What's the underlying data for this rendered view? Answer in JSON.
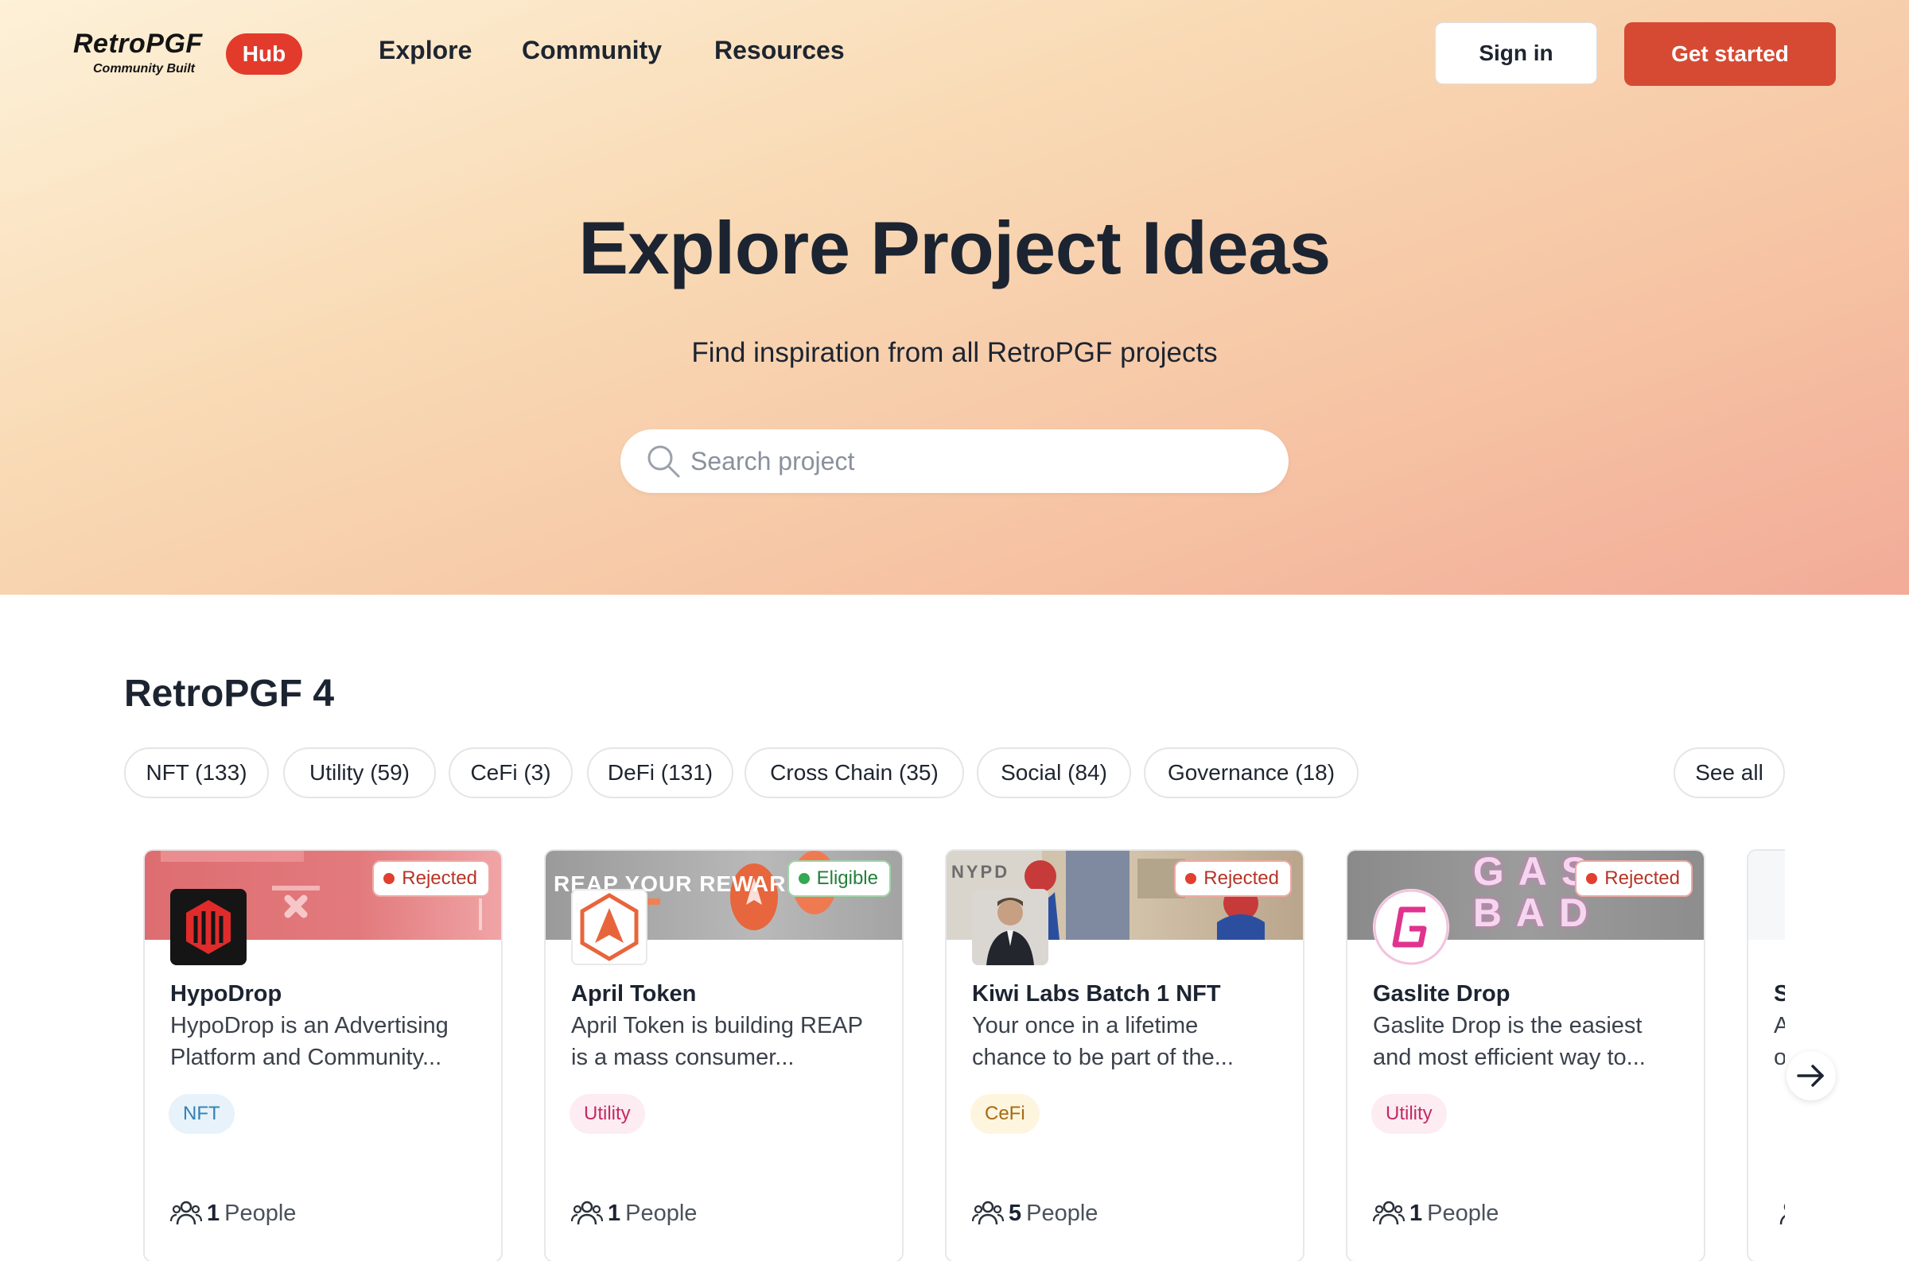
{
  "nav": {
    "logo_title": "RetroPGF",
    "logo_subtitle": "Community Built",
    "hub_badge": "Hub",
    "links": [
      "Explore",
      "Community",
      "Resources"
    ],
    "sign_in": "Sign in",
    "get_started": "Get started"
  },
  "hero": {
    "title": "Explore Project Ideas",
    "subtitle": "Find inspiration from all RetroPGF projects",
    "search_placeholder": "Search project"
  },
  "section": {
    "title": "RetroPGF 4",
    "categories": [
      "NFT (133)",
      "Utility (59)",
      "CeFi (3)",
      "DeFi (131)",
      "Cross Chain (35)",
      "Social (84)",
      "Governance (18)"
    ],
    "see_all": "See all"
  },
  "projects": [
    {
      "name": "HypoDrop",
      "desc_line1": "HypoDrop is an Advertising",
      "desc_line2": "Platform and Community...",
      "status": "Rejected",
      "tag": "NFT",
      "people_count": "1",
      "people_label": "People"
    },
    {
      "name": "April Token",
      "desc_line1": "April Token is building REAP",
      "desc_line2": "is a mass consumer...",
      "status": "Eligible",
      "tag": "Utility",
      "people_count": "1",
      "people_label": "People",
      "banner_text": "REAP YOUR REWARDS"
    },
    {
      "name": "Kiwi Labs Batch 1 NFT",
      "desc_line1": "Your once in a lifetime",
      "desc_line2": "chance to be part of the...",
      "status": "Rejected",
      "tag": "CeFi",
      "people_count": "5",
      "people_label": "People",
      "banner_text": "NYPD"
    },
    {
      "name": "Gaslite Drop",
      "desc_line1": "Gaslite Drop is the easiest",
      "desc_line2": "and most efficient way to...",
      "status": "Rejected",
      "tag": "Utility",
      "people_count": "1",
      "people_label": "People",
      "banner_text": "GAS BAD"
    },
    {
      "name": "S",
      "desc_line1": "A",
      "desc_line2": "o"
    }
  ],
  "icons": {
    "search": "search-icon",
    "people": "people-icon",
    "next": "arrow-right-icon"
  },
  "colors": {
    "brand_red": "#d64a33",
    "hub_red": "#e23b2c",
    "rejected": "#e0402f",
    "eligible": "#34a853"
  }
}
